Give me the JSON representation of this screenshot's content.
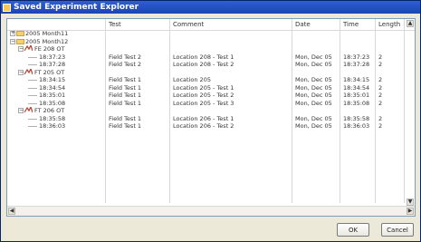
{
  "window": {
    "title": "Saved Experiment Explorer"
  },
  "columns": {
    "test": "Test",
    "comment": "Comment",
    "date": "Date",
    "time": "Time",
    "length": "Length"
  },
  "tree": [
    {
      "type": "folder",
      "label": "2005 Month11",
      "expander": "+",
      "level": 0
    },
    {
      "type": "folder",
      "label": "2005 Month12",
      "expander": "−",
      "level": 0
    },
    {
      "type": "experiment",
      "label": "FE 208 OT",
      "expander": "−",
      "level": 1
    },
    {
      "type": "entry",
      "label": "18:37:23",
      "test": "Field Test 2",
      "comment": "Location 208 - Test 1",
      "date": "Mon, Dec 05",
      "time": "18:37:23",
      "length": "2",
      "level": 2
    },
    {
      "type": "entry",
      "label": "18:37:28",
      "test": "Field Test 2",
      "comment": "Location 208 - Test 2",
      "date": "Mon, Dec 05",
      "time": "18:37:28",
      "length": "2",
      "level": 2
    },
    {
      "type": "experiment",
      "label": "FT 205 OT",
      "expander": "−",
      "level": 1
    },
    {
      "type": "entry",
      "label": "18:34:15",
      "test": "Field Test 1",
      "comment": "Location 205",
      "date": "Mon, Dec 05",
      "time": "18:34:15",
      "length": "2",
      "level": 2
    },
    {
      "type": "entry",
      "label": "18:34:54",
      "test": "Field Test 1",
      "comment": "Location 205 - Test 1",
      "date": "Mon, Dec 05",
      "time": "18:34:54",
      "length": "2",
      "level": 2
    },
    {
      "type": "entry",
      "label": "18:35:01",
      "test": "Field Test 1",
      "comment": "Location 205 - Test 2",
      "date": "Mon, Dec 05",
      "time": "18:35:01",
      "length": "2",
      "level": 2
    },
    {
      "type": "entry",
      "label": "18:35:08",
      "test": "Field Test 1",
      "comment": "Location 205 - Test 3",
      "date": "Mon, Dec 05",
      "time": "18:35:08",
      "length": "2",
      "level": 2
    },
    {
      "type": "experiment",
      "label": "FT 206 OT",
      "expander": "−",
      "level": 1
    },
    {
      "type": "entry",
      "label": "18:35:58",
      "test": "Field Test 1",
      "comment": "Location 206 - Test 1",
      "date": "Mon, Dec 05",
      "time": "18:35:58",
      "length": "2",
      "level": 2
    },
    {
      "type": "entry",
      "label": "18:36:03",
      "test": "Field Test 1",
      "comment": "Location 206 - Test 2",
      "date": "Mon, Dec 05",
      "time": "18:36:03",
      "length": "2",
      "level": 2
    }
  ],
  "icons": {
    "folder": "folder-icon",
    "experiment": "experiment-icon",
    "app": "app-icon"
  },
  "buttons": {
    "ok": "OK",
    "cancel": "Cancel"
  },
  "colors": {
    "titlebar": "#1c44b5",
    "folder": "#f4d06c",
    "experiment": "#c0392b"
  }
}
